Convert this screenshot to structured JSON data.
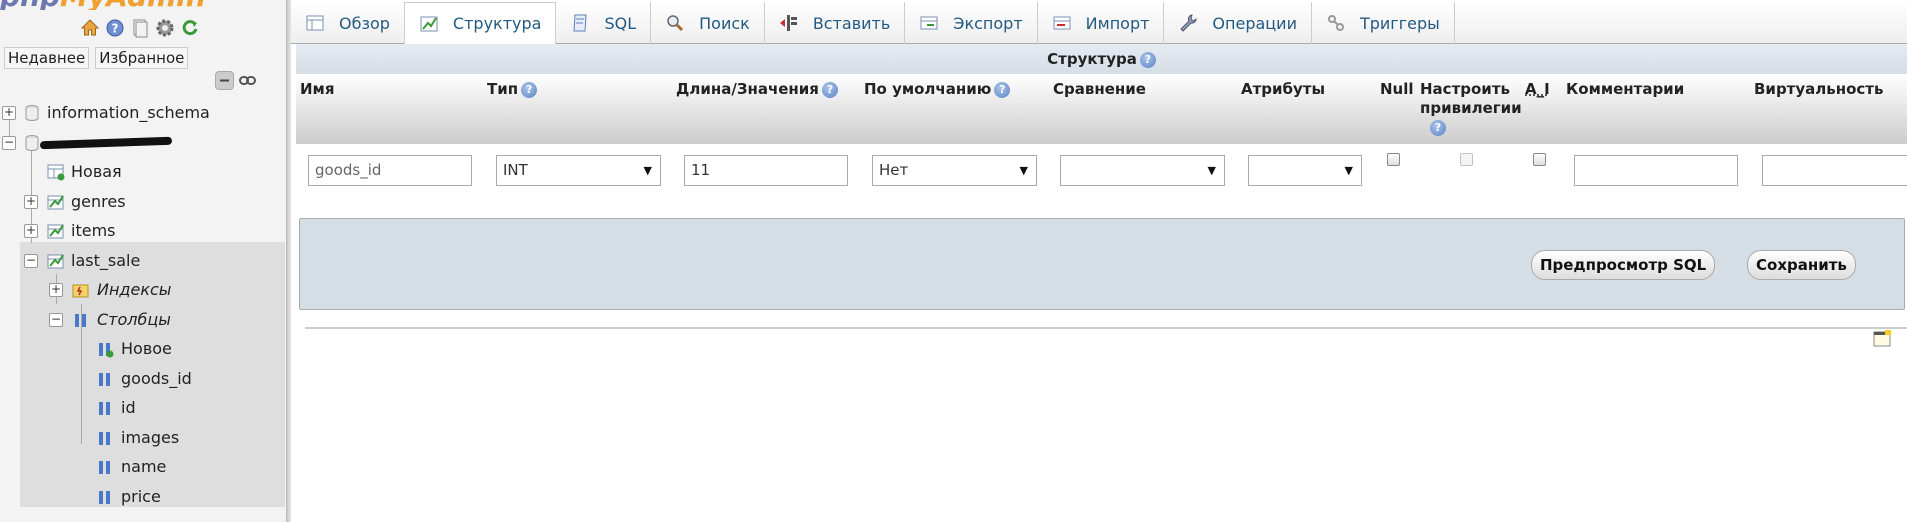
{
  "nav": {
    "logo_a": "php",
    "logo_b": "MyAdmin",
    "icons": [
      "home-icon",
      "help-icon",
      "docs-icon",
      "settings-icon",
      "reload-icon"
    ],
    "tabs": {
      "recent": "Недавнее",
      "favorites": "Избранное"
    },
    "tree": {
      "information_schema": "information_schema",
      "new_table": "Новая",
      "genres": "genres",
      "items": "items",
      "last_sale": "last_sale",
      "indexes": "Индексы",
      "columns": "Столбцы",
      "new_column": "Новое",
      "column_names": [
        "goods_id",
        "id",
        "images",
        "name",
        "price"
      ]
    }
  },
  "tabs": [
    {
      "label": "Обзор",
      "icon": "browse-icon"
    },
    {
      "label": "Структура",
      "icon": "structure-icon"
    },
    {
      "label": "SQL",
      "icon": "sql-icon"
    },
    {
      "label": "Поиск",
      "icon": "search-icon"
    },
    {
      "label": "Вставить",
      "icon": "insert-icon"
    },
    {
      "label": "Экспорт",
      "icon": "export-icon"
    },
    {
      "label": "Импорт",
      "icon": "import-icon"
    },
    {
      "label": "Операции",
      "icon": "wrench-icon"
    },
    {
      "label": "Триггеры",
      "icon": "triggers-icon"
    }
  ],
  "structure": {
    "title": "Структура",
    "columns": {
      "name": "Имя",
      "type": "Тип",
      "length": "Длина/Значения",
      "default": "По умолчанию",
      "collation": "Сравнение",
      "attributes": "Атрибуты",
      "null": "Null",
      "privileges": "Настроить привилегии",
      "ai": "A_I",
      "comments": "Комментарии",
      "virtual": "Виртуальность"
    },
    "row": {
      "name": "goods_id",
      "type": "INT",
      "length": "11",
      "default": "Нет",
      "collation": "",
      "attributes": ""
    }
  },
  "actions": {
    "preview_sql": "Предпросмотр SQL",
    "save": "Сохранить"
  },
  "colors": {
    "link": "#235a81",
    "header_bg": "#d5dde5",
    "highlight": "#dedede"
  }
}
